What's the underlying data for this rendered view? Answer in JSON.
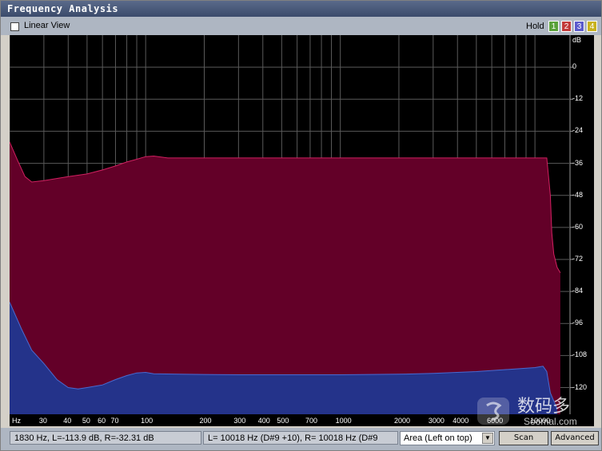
{
  "window": {
    "title": "Frequency Analysis"
  },
  "toolbar": {
    "linear_view_label": "Linear View",
    "linear_view_checked": false,
    "hold_label": "Hold",
    "hold_buttons": [
      {
        "label": "1",
        "color": "#59a13a"
      },
      {
        "label": "2",
        "color": "#c23a3a"
      },
      {
        "label": "3",
        "color": "#5a5acc"
      },
      {
        "label": "4",
        "color": "#c9b21e"
      }
    ]
  },
  "chart_data": {
    "type": "area",
    "x_scale": "log",
    "xlabel": "Hz",
    "ylabel": "dB",
    "x_tick_labels": [
      {
        "x": 30,
        "label": "30"
      },
      {
        "x": 40,
        "label": "40"
      },
      {
        "x": 50,
        "label": "50"
      },
      {
        "x": 60,
        "label": "60"
      },
      {
        "x": 70,
        "label": "70"
      },
      {
        "x": 100,
        "label": "100"
      },
      {
        "x": 200,
        "label": "200"
      },
      {
        "x": 300,
        "label": "300"
      },
      {
        "x": 400,
        "label": "400"
      },
      {
        "x": 500,
        "label": "500"
      },
      {
        "x": 700,
        "label": "700"
      },
      {
        "x": 1000,
        "label": "1000"
      },
      {
        "x": 2000,
        "label": "2000"
      },
      {
        "x": 3000,
        "label": "3000"
      },
      {
        "x": 4000,
        "label": "4000"
      },
      {
        "x": 6000,
        "label": "6000"
      },
      {
        "x": 10000,
        "label": "10000"
      }
    ],
    "x_gridlines": [
      20,
      30,
      40,
      50,
      60,
      70,
      80,
      90,
      100,
      200,
      300,
      400,
      500,
      600,
      700,
      800,
      900,
      1000,
      2000,
      3000,
      4000,
      5000,
      6000,
      7000,
      8000,
      9000,
      10000
    ],
    "y_ticks": [
      0,
      -12,
      -24,
      -36,
      -48,
      -60,
      -72,
      -84,
      -96,
      -108,
      -120
    ],
    "xlim": [
      20,
      15000
    ],
    "ylim": [
      -130,
      12
    ],
    "grid": true,
    "series": [
      {
        "color": "#630028",
        "line_color": "#d02060",
        "points": [
          [
            20,
            -28
          ],
          [
            22,
            -35
          ],
          [
            24,
            -41
          ],
          [
            26,
            -43
          ],
          [
            30,
            -42.5
          ],
          [
            40,
            -41
          ],
          [
            50,
            -40
          ],
          [
            60,
            -38.5
          ],
          [
            70,
            -37
          ],
          [
            80,
            -35.5
          ],
          [
            90,
            -34.5
          ],
          [
            100,
            -33.5
          ],
          [
            110,
            -33.3
          ],
          [
            130,
            -34
          ],
          [
            200,
            -34
          ],
          [
            500,
            -34
          ],
          [
            1000,
            -34
          ],
          [
            2000,
            -34
          ],
          [
            5000,
            -34
          ],
          [
            10000,
            -34
          ],
          [
            11500,
            -34
          ],
          [
            12000,
            -48
          ],
          [
            12200,
            -62
          ],
          [
            12500,
            -70
          ],
          [
            13000,
            -75
          ],
          [
            13500,
            -77
          ]
        ]
      },
      {
        "color": "#24338a",
        "line_color": "#4a6ad0",
        "points": [
          [
            20,
            -88
          ],
          [
            23,
            -98
          ],
          [
            26,
            -106
          ],
          [
            30,
            -111
          ],
          [
            35,
            -117
          ],
          [
            40,
            -120
          ],
          [
            45,
            -120.5
          ],
          [
            50,
            -120
          ],
          [
            60,
            -119
          ],
          [
            70,
            -117
          ],
          [
            80,
            -115.5
          ],
          [
            90,
            -114.5
          ],
          [
            100,
            -114.3
          ],
          [
            110,
            -114.8
          ],
          [
            150,
            -115
          ],
          [
            300,
            -115.2
          ],
          [
            1000,
            -115.2
          ],
          [
            2000,
            -115
          ],
          [
            3000,
            -114.7
          ],
          [
            5000,
            -114
          ],
          [
            10000,
            -112.5
          ],
          [
            11000,
            -112
          ],
          [
            11500,
            -114
          ],
          [
            12000,
            -122
          ],
          [
            13000,
            -128
          ]
        ]
      }
    ]
  },
  "status": {
    "cursor_readout": "1830 Hz, L=-113.9 dB, R=-32.31 dB",
    "peak_readout": "L=  10018 Hz (D#9 +10), R=  10018 Hz (D#9",
    "area_option": "Area (Left on top)",
    "scan_label": "Scan",
    "advanced_label": "Advanced"
  },
  "watermark": {
    "brand_cn": "数码多",
    "domain": "Soomal.com"
  }
}
